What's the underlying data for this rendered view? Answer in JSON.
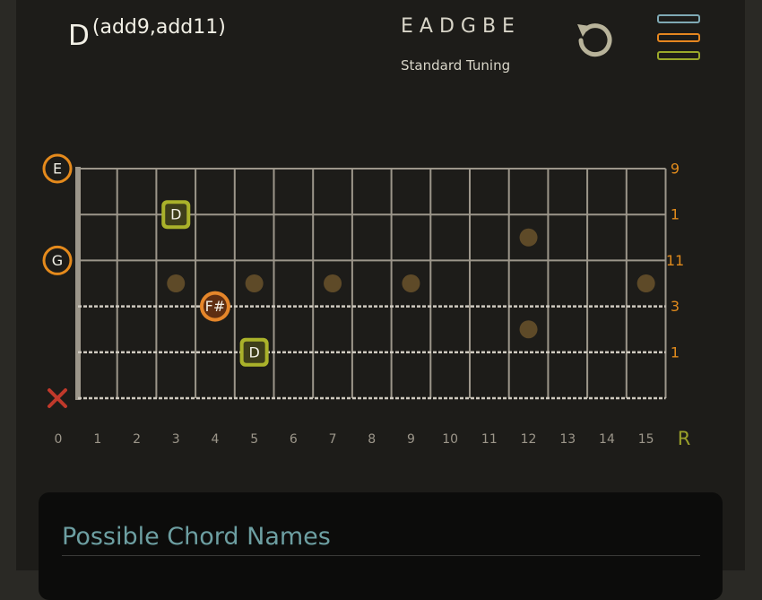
{
  "chord": {
    "root": "D",
    "extension": "(add9,add11)"
  },
  "tuning": {
    "notes": "EADGBE",
    "name": "Standard Tuning"
  },
  "colors": {
    "app_bg": "#1d1c19",
    "fret_line": "#9c968a",
    "string_dashed": "#cfcac0",
    "inlay": "#5e4a28",
    "open_ring": "#e58a1c",
    "root_fill": "#aab22a",
    "third_fill": "#e5862a",
    "mute_x": "#c0392b",
    "interval_label": "#e08a1c",
    "fret_number": "#9c968a",
    "root_label": "#9aa02a",
    "menu_bar_1": "#7fa9b4",
    "menu_bar_2": "#e5861f",
    "menu_bar_3": "#9aa82a",
    "card_title": "#6d9fa2"
  },
  "icons": {
    "undo": "undo-icon",
    "menu": "menu-icon"
  },
  "fretboard": {
    "fret_numbers": [
      "0",
      "1",
      "2",
      "3",
      "4",
      "5",
      "6",
      "7",
      "8",
      "9",
      "10",
      "11",
      "12",
      "13",
      "14",
      "15"
    ],
    "root_label": "R",
    "inlay_frets": [
      3,
      5,
      7,
      9,
      12,
      15
    ],
    "strings": [
      {
        "open": "E",
        "interval": "9",
        "style": "solid"
      },
      {
        "open": "",
        "interval": "1",
        "style": "solid"
      },
      {
        "open": "G",
        "interval": "11",
        "style": "solid"
      },
      {
        "open": "",
        "interval": "3",
        "style": "dashed"
      },
      {
        "open": "",
        "interval": "1",
        "style": "dashed"
      },
      {
        "open": "x",
        "interval": "",
        "style": "dashed"
      }
    ],
    "notes": [
      {
        "string": 1,
        "fret": 3,
        "label": "D",
        "kind": "root"
      },
      {
        "string": 3,
        "fret": 4,
        "label": "F#",
        "kind": "third"
      },
      {
        "string": 4,
        "fret": 5,
        "label": "D",
        "kind": "root"
      }
    ]
  },
  "panel": {
    "title": "Possible Chord Names"
  }
}
